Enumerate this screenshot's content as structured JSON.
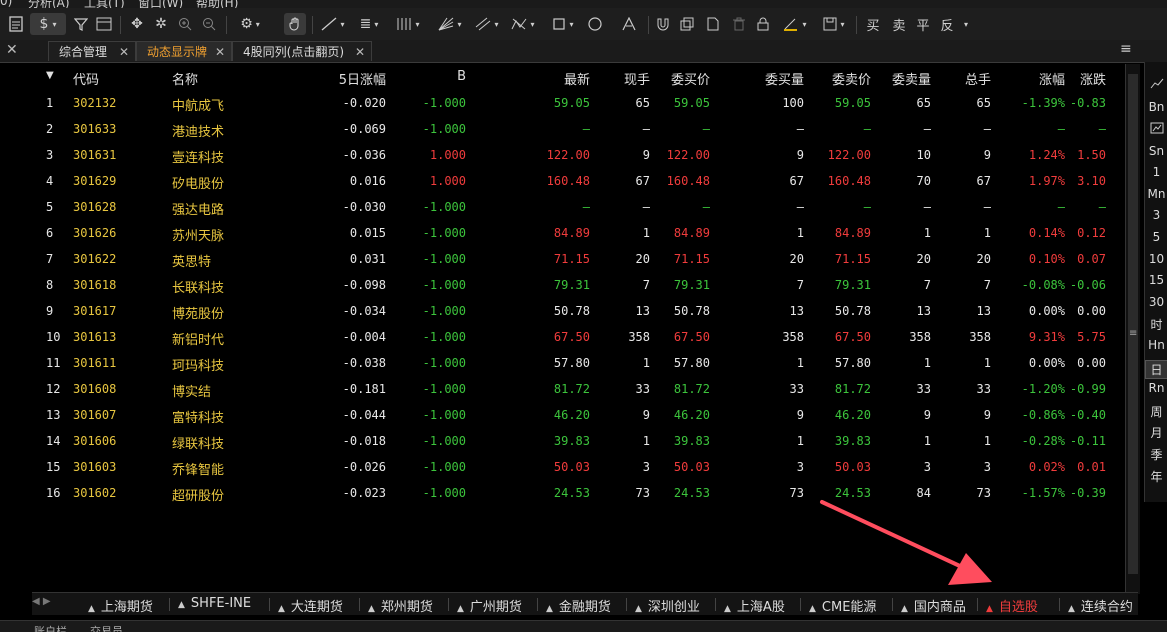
{
  "menubar": {
    "items": [
      "分析(A)",
      "工具(T)",
      "窗口(W)",
      "帮助(H)"
    ]
  },
  "toolbar": {
    "trade_buttons": [
      "买",
      "卖",
      "平",
      "反"
    ]
  },
  "tabs": [
    {
      "label": "综合管理",
      "active": false
    },
    {
      "label": "动态显示牌",
      "active": true
    },
    {
      "label": "4股同列(点击翻页)",
      "active": false
    }
  ],
  "table": {
    "columns": [
      "代码",
      "名称",
      "5日涨幅",
      "B",
      "最新",
      "现手",
      "委买价",
      "委买量",
      "委卖价",
      "委卖量",
      "总手",
      "涨幅",
      "涨跌"
    ],
    "rows": [
      {
        "idx": "1",
        "code": "302132",
        "name": "中航成飞",
        "chg5": "-0.020",
        "b": "-1.000",
        "last": "59.05",
        "cur": "65",
        "bid": "59.05",
        "bidv": "100",
        "ask": "59.05",
        "askv": "65",
        "vol": "65",
        "pct": "-1.39%",
        "chg": "-0.83",
        "color": "green"
      },
      {
        "idx": "2",
        "code": "301633",
        "name": "港迪技术",
        "chg5": "-0.069",
        "b": "-1.000",
        "last": "—",
        "cur": "—",
        "bid": "—",
        "bidv": "—",
        "ask": "—",
        "askv": "—",
        "vol": "—",
        "pct": "—",
        "chg": "—",
        "color": "green"
      },
      {
        "idx": "3",
        "code": "301631",
        "name": "壹连科技",
        "chg5": "-0.036",
        "b": "1.000",
        "last": "122.00",
        "cur": "9",
        "bid": "122.00",
        "bidv": "9",
        "ask": "122.00",
        "askv": "10",
        "vol": "9",
        "pct": "1.24%",
        "chg": "1.50",
        "color": "red"
      },
      {
        "idx": "4",
        "code": "301629",
        "name": "矽电股份",
        "chg5": "0.016",
        "b": "1.000",
        "last": "160.48",
        "cur": "67",
        "bid": "160.48",
        "bidv": "67",
        "ask": "160.48",
        "askv": "70",
        "vol": "67",
        "pct": "1.97%",
        "chg": "3.10",
        "color": "red"
      },
      {
        "idx": "5",
        "code": "301628",
        "name": "强达电路",
        "chg5": "-0.030",
        "b": "-1.000",
        "last": "—",
        "cur": "—",
        "bid": "—",
        "bidv": "—",
        "ask": "—",
        "askv": "—",
        "vol": "—",
        "pct": "—",
        "chg": "—",
        "color": "green"
      },
      {
        "idx": "6",
        "code": "301626",
        "name": "苏州天脉",
        "chg5": "0.015",
        "b": "-1.000",
        "last": "84.89",
        "cur": "1",
        "bid": "84.89",
        "bidv": "1",
        "ask": "84.89",
        "askv": "1",
        "vol": "1",
        "pct": "0.14%",
        "chg": "0.12",
        "color": "red"
      },
      {
        "idx": "7",
        "code": "301622",
        "name": "英思特",
        "chg5": "0.031",
        "b": "-1.000",
        "last": "71.15",
        "cur": "20",
        "bid": "71.15",
        "bidv": "20",
        "ask": "71.15",
        "askv": "20",
        "vol": "20",
        "pct": "0.10%",
        "chg": "0.07",
        "color": "red"
      },
      {
        "idx": "8",
        "code": "301618",
        "name": "长联科技",
        "chg5": "-0.098",
        "b": "-1.000",
        "last": "79.31",
        "cur": "7",
        "bid": "79.31",
        "bidv": "7",
        "ask": "79.31",
        "askv": "7",
        "vol": "7",
        "pct": "-0.08%",
        "chg": "-0.06",
        "color": "green"
      },
      {
        "idx": "9",
        "code": "301617",
        "name": "博苑股份",
        "chg5": "-0.034",
        "b": "-1.000",
        "last": "50.78",
        "cur": "13",
        "bid": "50.78",
        "bidv": "13",
        "ask": "50.78",
        "askv": "13",
        "vol": "13",
        "pct": "0.00%",
        "chg": "0.00",
        "color": "white"
      },
      {
        "idx": "10",
        "code": "301613",
        "name": "新铝时代",
        "chg5": "-0.004",
        "b": "-1.000",
        "last": "67.50",
        "cur": "358",
        "bid": "67.50",
        "bidv": "358",
        "ask": "67.50",
        "askv": "358",
        "vol": "358",
        "pct": "9.31%",
        "chg": "5.75",
        "color": "red"
      },
      {
        "idx": "11",
        "code": "301611",
        "name": "珂玛科技",
        "chg5": "-0.038",
        "b": "-1.000",
        "last": "57.80",
        "cur": "1",
        "bid": "57.80",
        "bidv": "1",
        "ask": "57.80",
        "askv": "1",
        "vol": "1",
        "pct": "0.00%",
        "chg": "0.00",
        "color": "white"
      },
      {
        "idx": "12",
        "code": "301608",
        "name": "博实结",
        "chg5": "-0.181",
        "b": "-1.000",
        "last": "81.72",
        "cur": "33",
        "bid": "81.72",
        "bidv": "33",
        "ask": "81.72",
        "askv": "33",
        "vol": "33",
        "pct": "-1.20%",
        "chg": "-0.99",
        "color": "green"
      },
      {
        "idx": "13",
        "code": "301607",
        "name": "富特科技",
        "chg5": "-0.044",
        "b": "-1.000",
        "last": "46.20",
        "cur": "9",
        "bid": "46.20",
        "bidv": "9",
        "ask": "46.20",
        "askv": "9",
        "vol": "9",
        "pct": "-0.86%",
        "chg": "-0.40",
        "color": "green"
      },
      {
        "idx": "14",
        "code": "301606",
        "name": "绿联科技",
        "chg5": "-0.018",
        "b": "-1.000",
        "last": "39.83",
        "cur": "1",
        "bid": "39.83",
        "bidv": "1",
        "ask": "39.83",
        "askv": "1",
        "vol": "1",
        "pct": "-0.28%",
        "chg": "-0.11",
        "color": "green"
      },
      {
        "idx": "15",
        "code": "301603",
        "name": "乔锋智能",
        "chg5": "-0.026",
        "b": "-1.000",
        "last": "50.03",
        "cur": "3",
        "bid": "50.03",
        "bidv": "3",
        "ask": "50.03",
        "askv": "3",
        "vol": "3",
        "pct": "0.02%",
        "chg": "0.01",
        "color": "red"
      },
      {
        "idx": "16",
        "code": "301602",
        "name": "超研股份",
        "chg5": "-0.023",
        "b": "-1.000",
        "last": "24.53",
        "cur": "73",
        "bid": "24.53",
        "bidv": "73",
        "ask": "24.53",
        "askv": "84",
        "vol": "73",
        "pct": "-1.57%",
        "chg": "-0.39",
        "color": "green"
      }
    ]
  },
  "right_panel": {
    "items": [
      "Bn",
      "Sn",
      "1",
      "Mn",
      "3",
      "5",
      "10",
      "15",
      "30",
      "时",
      "Hn",
      "日",
      "Rn",
      "周",
      "月",
      "季",
      "年"
    ],
    "selected": "日"
  },
  "bottom_tabs": [
    {
      "label": "上海期货",
      "active": false
    },
    {
      "label": "SHFE-INE",
      "active": false
    },
    {
      "label": "大连期货",
      "active": false
    },
    {
      "label": "郑州期货",
      "active": false
    },
    {
      "label": "广州期货",
      "active": false
    },
    {
      "label": "金融期货",
      "active": false
    },
    {
      "label": "深圳创业",
      "active": false
    },
    {
      "label": "上海A股",
      "active": false
    },
    {
      "label": "CME能源",
      "active": false
    },
    {
      "label": "国内商品",
      "active": false
    },
    {
      "label": "自选股",
      "active": true
    },
    {
      "label": "连续合约",
      "active": false
    }
  ],
  "status_bar": {
    "left": [
      "账户栏",
      "交易员"
    ]
  },
  "annotation": {
    "color": "#ff4d5e"
  }
}
